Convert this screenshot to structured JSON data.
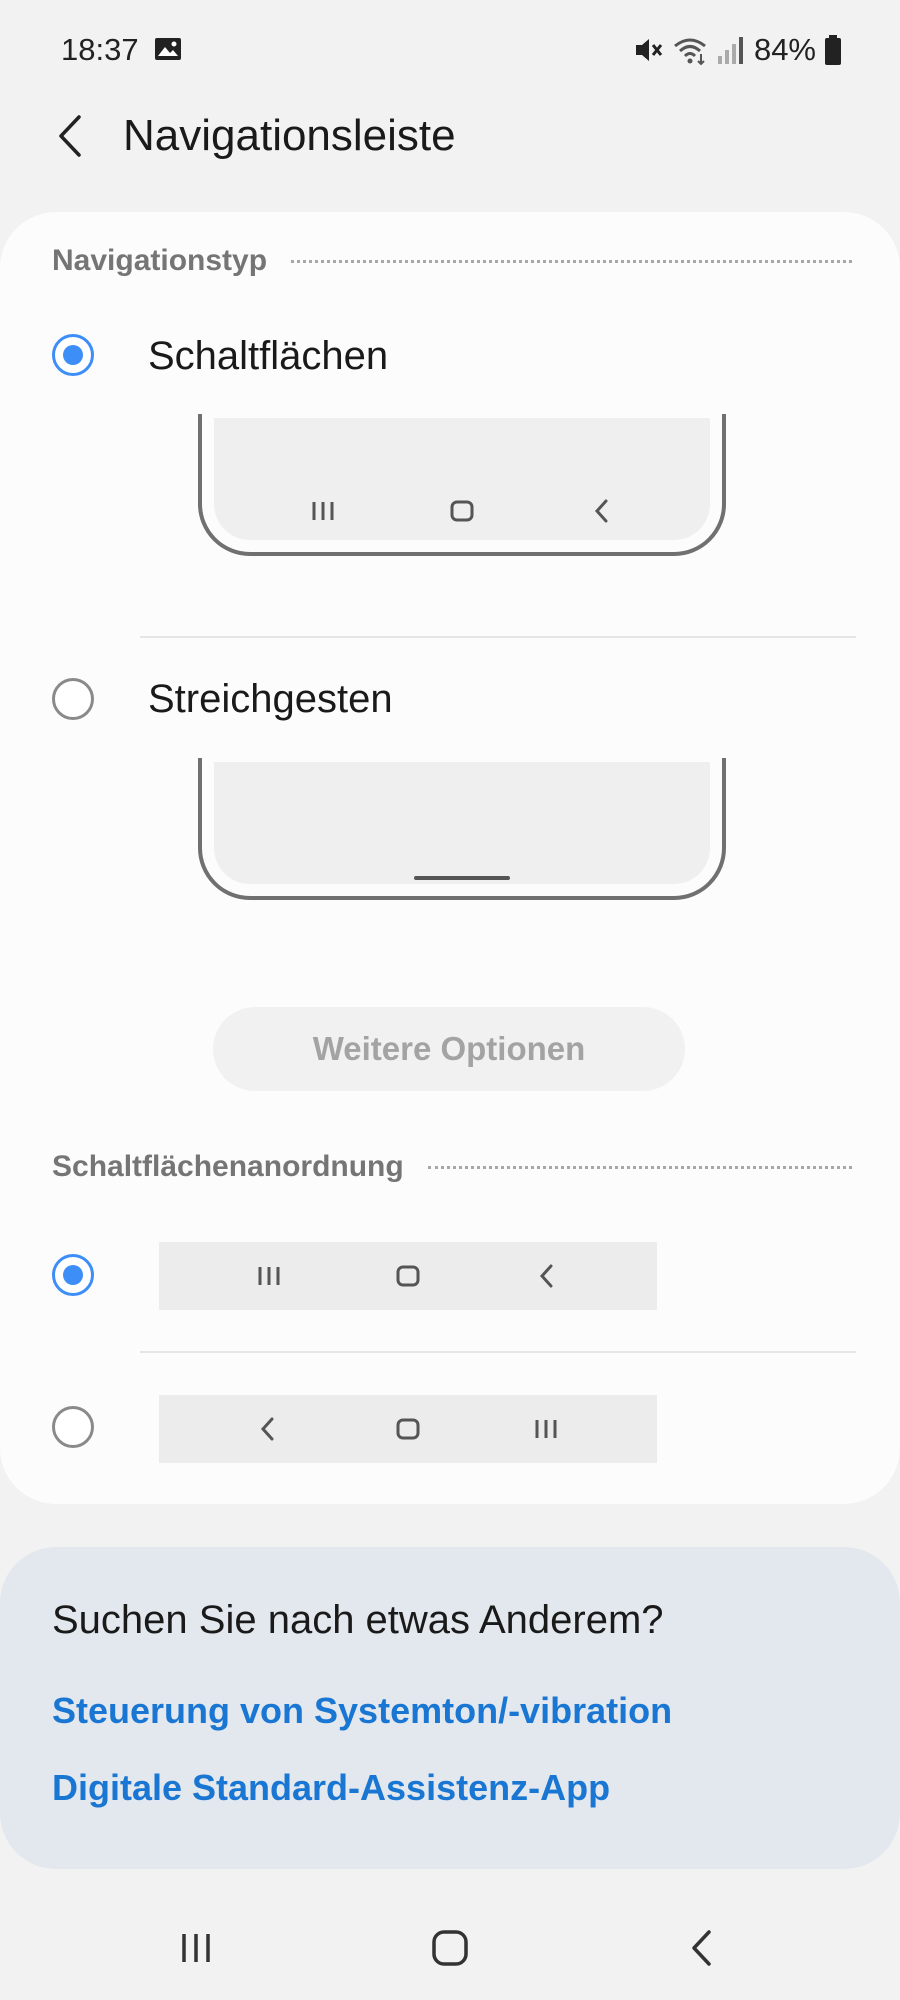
{
  "status_bar": {
    "time": "18:37",
    "battery": "84%",
    "icons": [
      "image-icon",
      "mute-icon",
      "wifi-icon",
      "signal-icon",
      "battery-icon"
    ]
  },
  "header": {
    "title": "Navigationsleiste",
    "back_icon": "back-arrow-icon"
  },
  "navigation_type": {
    "section_label": "Navigationstyp",
    "options": [
      {
        "label": "Schaltflächen",
        "selected": true
      },
      {
        "label": "Streichgesten",
        "selected": false
      }
    ],
    "more_options_label": "Weitere Optionen"
  },
  "button_order": {
    "section_label": "Schaltflächenanordnung",
    "options": [
      {
        "selected": true,
        "icons": [
          "recents-icon",
          "home-icon",
          "back-icon"
        ]
      },
      {
        "selected": false,
        "icons": [
          "back-icon",
          "home-icon",
          "recents-icon"
        ]
      }
    ]
  },
  "suggestions": {
    "title": "Suchen Sie nach etwas Anderem?",
    "links": [
      "Steuerung von Systemton/-vibration",
      "Digitale Standard-Assistenz-App"
    ]
  },
  "system_nav": {
    "icons": [
      "recents-icon",
      "home-icon",
      "back-icon"
    ]
  },
  "colors": {
    "accent": "#3e8ef7",
    "link": "#1976d2",
    "background": "#f2f2f2",
    "card": "#fcfcfc",
    "suggestion_card": "#e3e8ee"
  }
}
